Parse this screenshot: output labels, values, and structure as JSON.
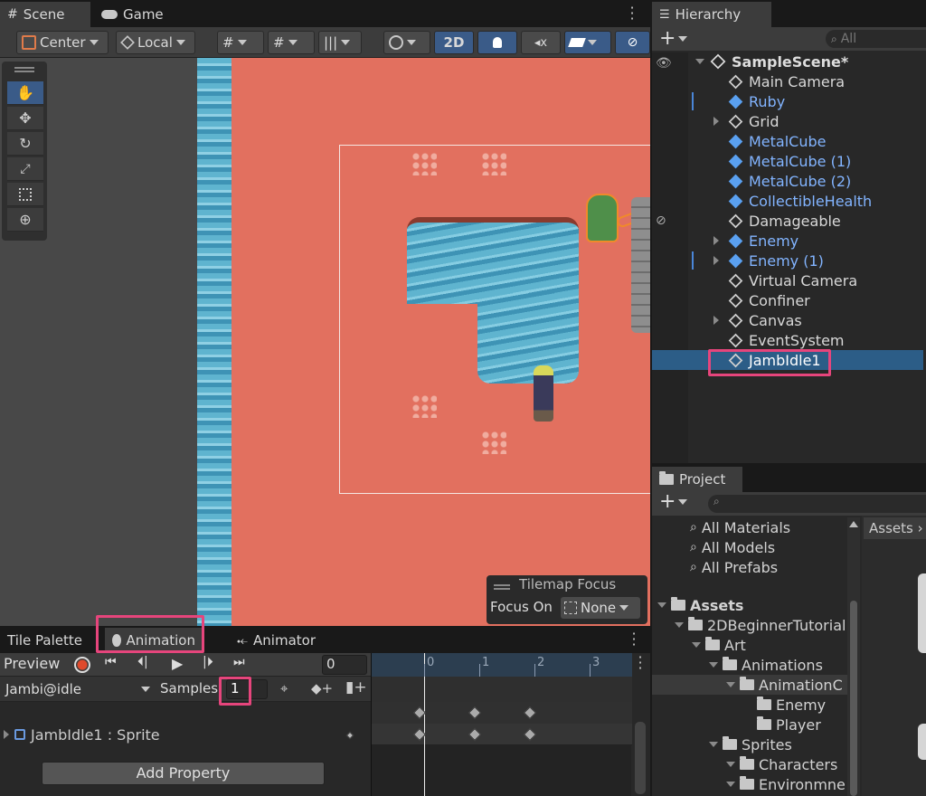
{
  "scene_tabs": {
    "scene": "Scene",
    "game": "Game"
  },
  "toolbar": {
    "pivot": "Center",
    "space": "Local",
    "mode_2d": "2D"
  },
  "hierarchy": {
    "title": "Hierarchy",
    "search_placeholder": "All",
    "scene_name": "SampleScene*",
    "items": [
      {
        "label": "Main Camera",
        "prefab": false,
        "expandable": false
      },
      {
        "label": "Ruby",
        "prefab": true,
        "expandable": false
      },
      {
        "label": "Grid",
        "prefab": false,
        "expandable": true
      },
      {
        "label": "MetalCube",
        "prefab": true,
        "expandable": false
      },
      {
        "label": "MetalCube (1)",
        "prefab": true,
        "expandable": false
      },
      {
        "label": "MetalCube (2)",
        "prefab": true,
        "expandable": false
      },
      {
        "label": "CollectibleHealth",
        "prefab": true,
        "expandable": false
      },
      {
        "label": "Damageable",
        "prefab": false,
        "expandable": false
      },
      {
        "label": "Enemy",
        "prefab": true,
        "expandable": true
      },
      {
        "label": "Enemy (1)",
        "prefab": true,
        "expandable": true
      },
      {
        "label": "Virtual Camera",
        "prefab": false,
        "expandable": false
      },
      {
        "label": "Confiner",
        "prefab": false,
        "expandable": false
      },
      {
        "label": "Canvas",
        "prefab": false,
        "expandable": true
      },
      {
        "label": "EventSystem",
        "prefab": false,
        "expandable": false
      },
      {
        "label": "JambIdle1",
        "prefab": false,
        "expandable": false,
        "selected": true
      }
    ]
  },
  "project": {
    "title": "Project",
    "favorites": [
      "All Materials",
      "All Models",
      "All Prefabs"
    ],
    "tree": [
      {
        "label": "Assets",
        "indent": 0,
        "bold": true
      },
      {
        "label": "2DBeginnerTutorial",
        "indent": 1
      },
      {
        "label": "Art",
        "indent": 2
      },
      {
        "label": "Animations",
        "indent": 3
      },
      {
        "label": "AnimationC",
        "indent": 4,
        "selected": true
      },
      {
        "label": "Enemy",
        "indent": 5
      },
      {
        "label": "Player",
        "indent": 5
      },
      {
        "label": "Sprites",
        "indent": 3
      },
      {
        "label": "Characters",
        "indent": 4
      },
      {
        "label": "Environmne",
        "indent": 4
      }
    ],
    "assets_tab": "Assets"
  },
  "tilemap_focus": {
    "title": "Tilemap Focus",
    "focus_on": "Focus On",
    "value": "None"
  },
  "bottom_tabs": {
    "tile_palette": "Tile Palette",
    "animation": "Animation",
    "animator": "Animator"
  },
  "animation": {
    "preview": "Preview",
    "frame": "0",
    "clip": "Jambi@idle",
    "samples_label": "Samples",
    "samples_value": "1",
    "property": "JambIdle1 : Sprite",
    "add_property": "Add Property",
    "timeline_marks": [
      "0",
      "1",
      "2",
      "3"
    ]
  },
  "colors": {
    "accent_selected": "#2c5d87",
    "highlight": "#e6457c",
    "ground": "#e2705f",
    "water": "#5fb4cf",
    "prefab_text": "#82b4ff"
  }
}
